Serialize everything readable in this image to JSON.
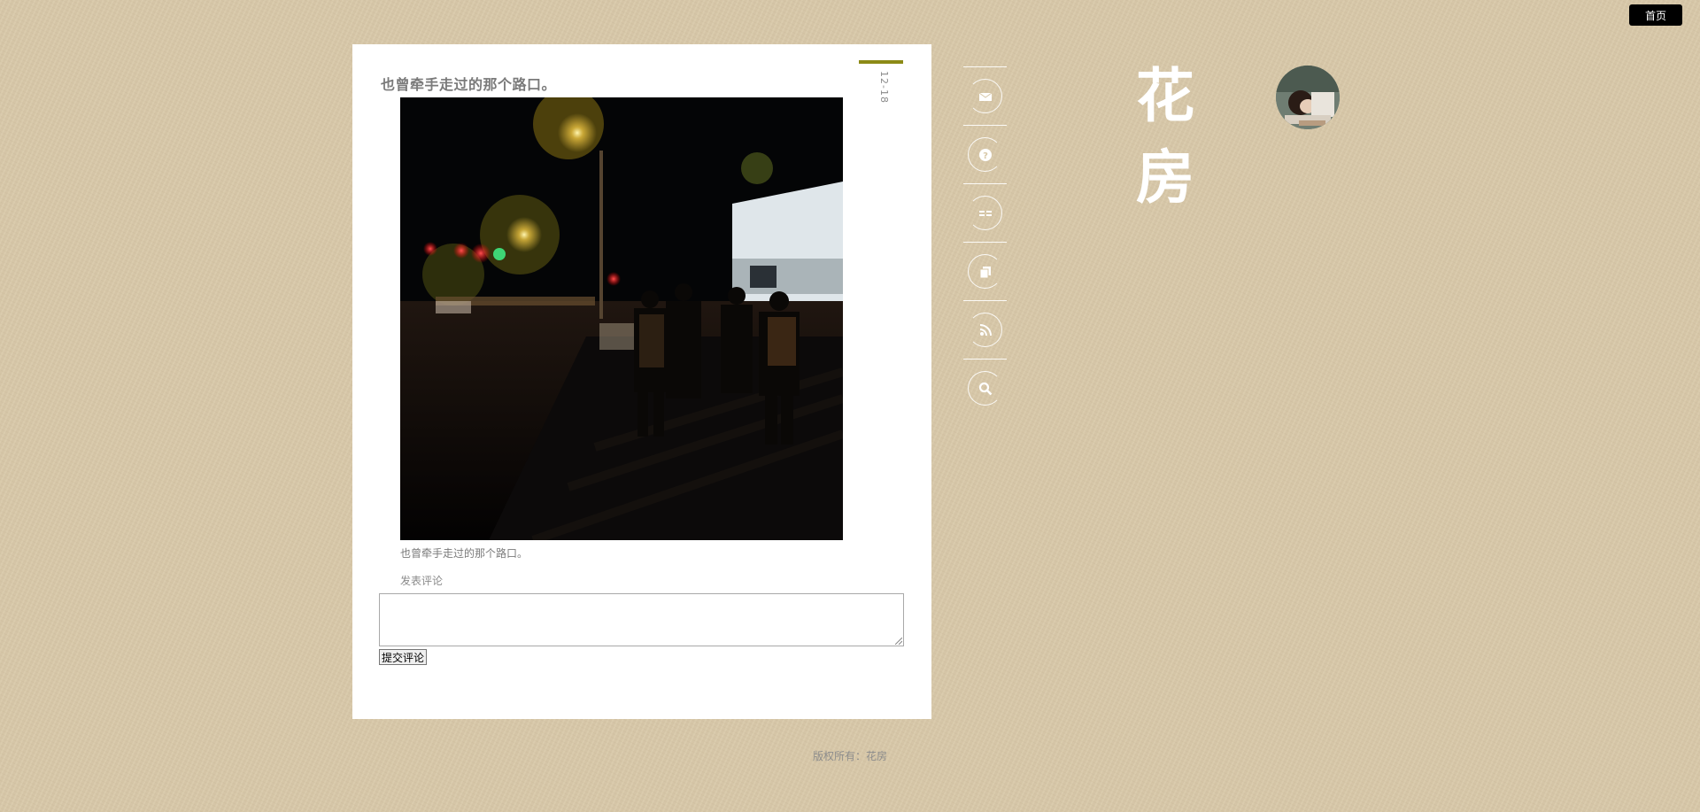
{
  "header": {
    "home_label": "首页"
  },
  "post": {
    "title": "也曾牵手走过的那个路口。",
    "date": "12-18",
    "photo_caption": "也曾牵手走过的那个路口。",
    "comment_heading": "发表评论",
    "comment_value": "",
    "submit_label": "提交评论"
  },
  "sidebar": {
    "nav": [
      {
        "icon": "mail-icon"
      },
      {
        "icon": "question-icon"
      },
      {
        "icon": "list-icon"
      },
      {
        "icon": "archive-icon"
      },
      {
        "icon": "rss-icon"
      },
      {
        "icon": "search-icon"
      }
    ],
    "site_title": "花房"
  },
  "footer": {
    "copyright": "版权所有：花房"
  },
  "colors": {
    "background": "#d8c8a8",
    "card": "#ffffff",
    "date_accent": "#8c8a16",
    "home_button": "#000000"
  }
}
